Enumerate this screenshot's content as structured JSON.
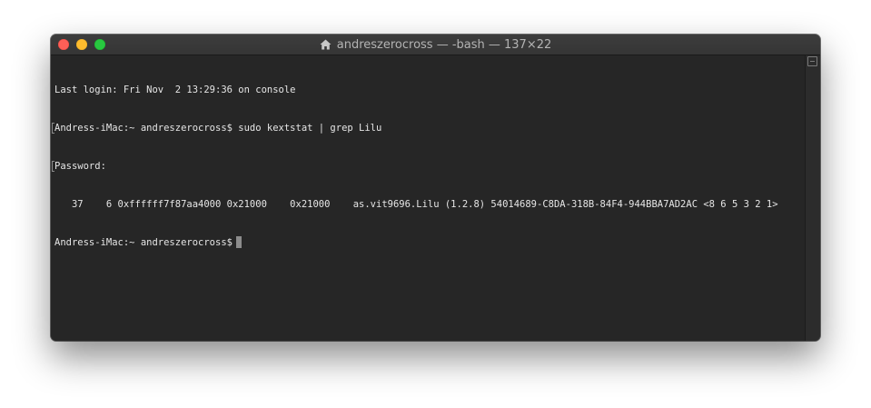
{
  "window": {
    "title": "andreszerocross — -bash — 137×22"
  },
  "terminal": {
    "lines": [
      "Last login: Fri Nov  2 13:29:36 on console",
      "Andress-iMac:~ andreszerocross$ sudo kextstat | grep Lilu",
      "Password:",
      "   37    6 0xffffff7f87aa4000 0x21000    0x21000    as.vit9696.Lilu (1.2.8) 54014689-C8DA-318B-84F4-944BBA7AD2AC <8 6 5 3 2 1>"
    ],
    "prompt": "Andress-iMac:~ andreszerocross$"
  },
  "colors": {
    "background": "#262626",
    "text": "#e6e6e6",
    "close": "#fe5f57",
    "minimize": "#febc2e",
    "maximize": "#28c840"
  },
  "icons": {
    "title": "home-icon",
    "scrollbar": "split-pane-icon"
  }
}
